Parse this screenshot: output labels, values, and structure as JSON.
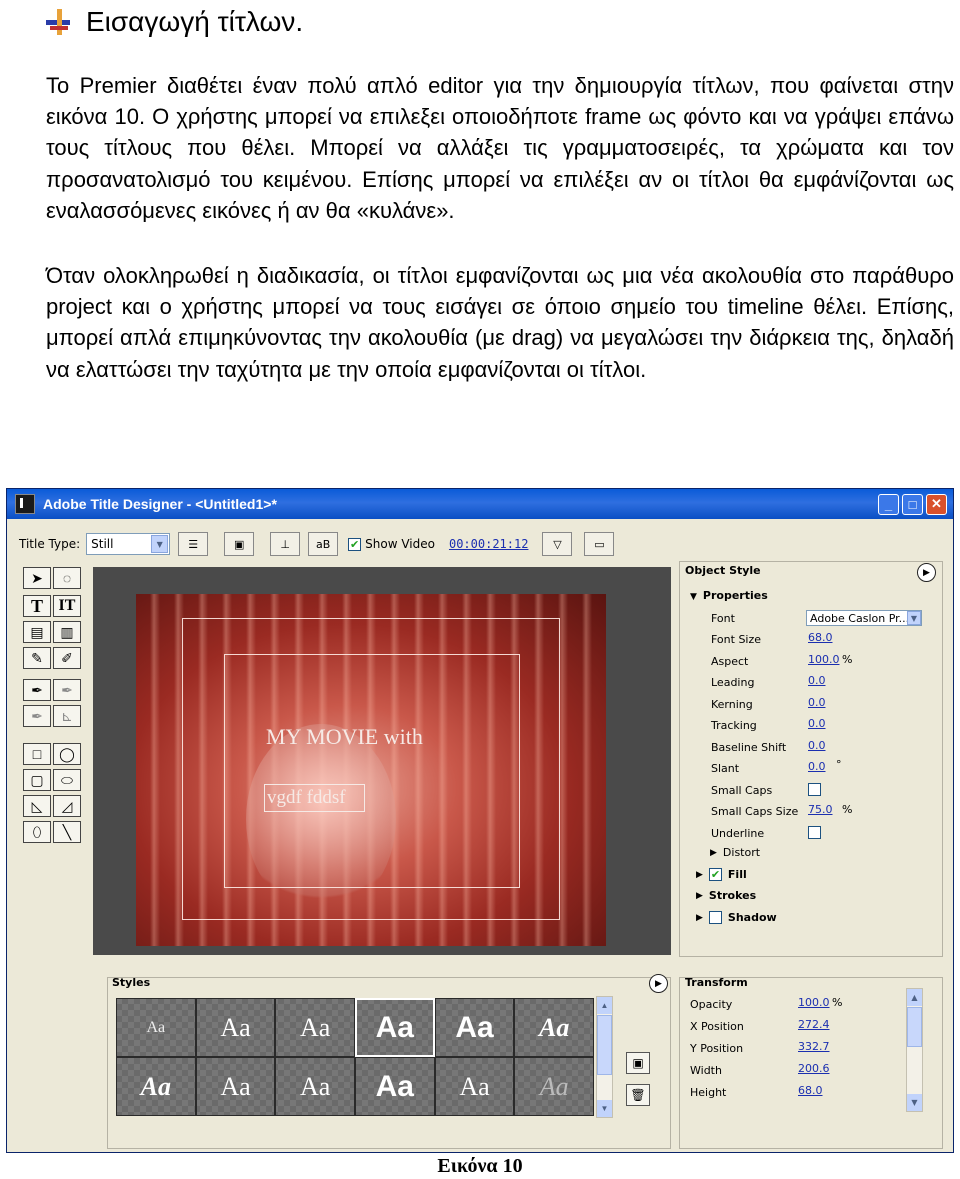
{
  "heading": "Εισαγωγή τίτλων.",
  "paragraph1": "Το Premier διαθέτει έναν πολύ απλό editor για την δημιουργία τίτλων, που φαίνεται στην εικόνα 10. Ο χρήστης μπορεί να επιλεξει οποιοδήποτε frame ως φόντο και να γράψει επάνω τους τίτλους που θέλει. Μπορεί να αλλάξει τις γραμματοσειρές, τα χρώματα και τον προσανατολισμό του κειμένου. Επίσης μπορεί να επιλέξει αν οι τίτλοι θα εμφάνίζονται ως εναλασσόμενες εικόνες ή αν θα «κυλάνε».",
  "paragraph2": "Όταν ολοκληρωθεί η διαδικασία, οι τίτλοι εμφανίζονται ως μια νέα ακολουθία στο παράθυρο project και ο χρήστης μπορεί να τους εισάγει σε όποιο σημείο του timeline θέλει. Επίσης, μπορεί απλά επιμηκύνοντας την ακολουθία (με drag) να μεγαλώσει την διάρκεια της, δηλαδή να ελαττώσει την ταχύτητα με την οποία εμφανίζονται οι τίτλοι.",
  "window": {
    "title": "Adobe Title Designer - <Untitled1>*",
    "toolbar": {
      "title_type_label": "Title Type:",
      "title_type_value": "Still",
      "show_video_label": "Show Video",
      "show_video_checked": true,
      "timecode": "00:00:21:12"
    },
    "canvas": {
      "title_line1": "MY  MOVIE  with",
      "title_line2": "vgdf  fddsf"
    },
    "object_style": {
      "label": "Object Style",
      "properties_label": "Properties",
      "properties": [
        {
          "name": "Font",
          "value": "Adobe Caslon Pr...",
          "kind": "select"
        },
        {
          "name": "Font Size",
          "value": "68.0"
        },
        {
          "name": "Aspect",
          "value": "100.0",
          "unit": "%"
        },
        {
          "name": "Leading",
          "value": "0.0"
        },
        {
          "name": "Kerning",
          "value": "0.0"
        },
        {
          "name": "Tracking",
          "value": "0.0"
        },
        {
          "name": "Baseline Shift",
          "value": "0.0"
        },
        {
          "name": "Slant",
          "value": "0.0",
          "unit": "°"
        },
        {
          "name": "Small Caps",
          "kind": "checkbox",
          "checked": false
        },
        {
          "name": "Small Caps Size",
          "value": "75.0",
          "unit": "%"
        },
        {
          "name": "Underline",
          "kind": "checkbox",
          "checked": false
        }
      ],
      "distort_label": "Distort",
      "fill_label": "Fill",
      "fill_checked": true,
      "strokes_label": "Strokes",
      "shadow_label": "Shadow",
      "shadow_checked": false
    },
    "styles": {
      "label": "Styles",
      "swatches": [
        "Aa",
        "Aa",
        "Aa",
        "Aa",
        "Aa",
        "Aa",
        "Aa",
        "Aa",
        "Aa",
        "Aa",
        "Aa",
        "Aa"
      ]
    },
    "transform": {
      "label": "Transform",
      "rows": [
        {
          "name": "Opacity",
          "value": "100.0",
          "unit": "%"
        },
        {
          "name": "X Position",
          "value": "272.4"
        },
        {
          "name": "Y Position",
          "value": "332.7"
        },
        {
          "name": "Width",
          "value": "200.6"
        },
        {
          "name": "Height",
          "value": "68.0"
        }
      ]
    }
  },
  "caption": "Εικόνα 10"
}
